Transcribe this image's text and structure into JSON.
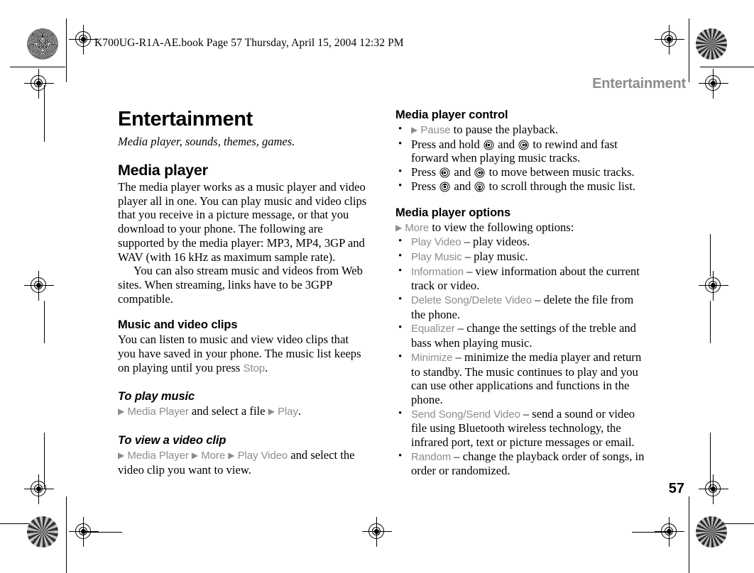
{
  "file_strip": "K700UG-R1A-AE.book  Page 57  Thursday, April 15, 2004  12:32 PM",
  "running_header": "Entertainment",
  "folio": "57",
  "colors": {
    "ui_term_gray": "#8c8c8c",
    "header_gray": "#8c8c8c",
    "body_black": "#000000"
  },
  "left_column": {
    "chapter_title": "Entertainment",
    "chapter_subtitle": "Media player, sounds, themes, games.",
    "media_player_heading": "Media player",
    "media_player_para_1": "The media player works as a music player and video player all in one. You can play music and video clips that you receive in a picture message, or that you download to your phone. The following are supported by the media player: MP3, MP4, 3GP and WAV (with 16 kHz as maximum sample rate).",
    "media_player_para_2": "You can also stream music and videos from Web sites. When streaming, links have to be 3GPP compatible.",
    "music_video_heading": "Music and video clips",
    "music_video_para_a": "You can listen to music and view video clips that you have saved in your phone. The music list keeps on playing until you press ",
    "music_video_stop_term": "Stop",
    "music_video_para_b": ".",
    "to_play_music_heading": "To play music",
    "to_play_music_term_1": "Media Player",
    "to_play_music_mid": " and select a file ",
    "to_play_music_term_2": "Play",
    "to_play_music_end": ".",
    "to_view_video_heading": "To view a video clip",
    "to_view_video_term_1": "Media Player",
    "to_view_video_term_2": "More",
    "to_view_video_term_3": "Play Video",
    "to_view_video_tail": " and select the video clip you want to view.",
    "arrow_glyph": "▶"
  },
  "right_column": {
    "control_heading": "Media player control",
    "control_items": [
      {
        "term": "Pause",
        "lead_arrow": true,
        "text_after": " to pause the playback."
      },
      {
        "text_before": "Press and hold ",
        "icon_1": "nav-key-left-icon",
        "text_mid": " and ",
        "icon_2": "nav-key-right-icon",
        "text_after": " to rewind and fast forward when playing music tracks."
      },
      {
        "text_before": "Press ",
        "icon_1": "nav-key-left-icon",
        "text_mid": " and ",
        "icon_2": "nav-key-right-icon",
        "text_after": " to move between music tracks."
      },
      {
        "text_before": "Press ",
        "icon_1": "nav-key-up-icon",
        "text_mid": " and ",
        "icon_2": "nav-key-down-icon",
        "text_after": " to scroll through the music list."
      }
    ],
    "options_heading": "Media player options",
    "options_intro_term": "More",
    "options_intro_tail": " to view the following options:",
    "options": [
      {
        "term": "Play Video",
        "desc": " – play videos."
      },
      {
        "term": "Play Music",
        "desc": " – play music."
      },
      {
        "term": "Information",
        "desc": " – view information about the current track or video."
      },
      {
        "term": "Delete Song/Delete Video",
        "desc": " – delete the file from the phone."
      },
      {
        "term": "Equalizer",
        "desc": " – change the settings of the treble and bass when playing music."
      },
      {
        "term": "Minimize",
        "desc": " – minimize the media player and return to standby. The music continues to play and you can use other applications and functions in the phone."
      },
      {
        "term": "Send Song/Send Video",
        "desc": " – send a sound or video file using Bluetooth wireless technology, the infrared port, text or picture messages or email."
      },
      {
        "term": "Random",
        "desc": " – change the playback order of songs, in order or randomized."
      }
    ]
  }
}
